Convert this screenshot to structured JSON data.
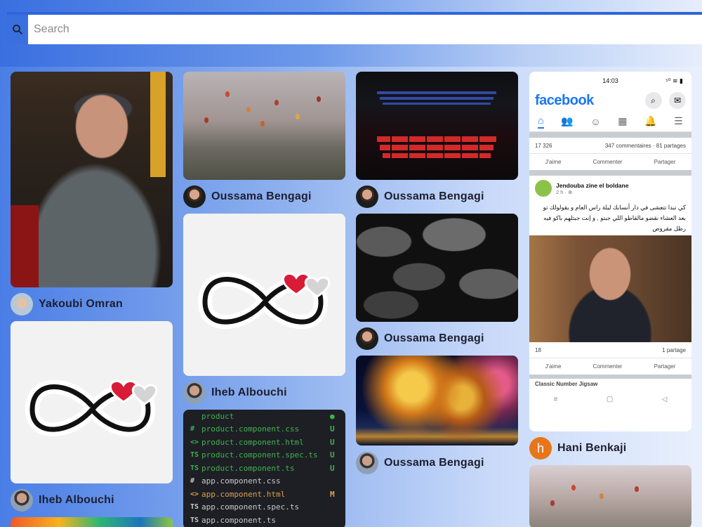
{
  "search": {
    "placeholder": "Search"
  },
  "pins": {
    "c1": [
      {
        "author": "Yakoubi Omran"
      },
      {
        "author": "Iheb Albouchi"
      }
    ],
    "c2": [
      {
        "author": "Oussama Bengagi"
      },
      {
        "author": "Iheb Albouchi"
      }
    ],
    "c3": [
      {
        "author": "Oussama Bengagi"
      },
      {
        "author": "Oussama Bengagi"
      },
      {
        "author": "Oussama Bengagi"
      }
    ],
    "c4": [
      {
        "author": "Hani Benkaji",
        "avatar_letter": "h"
      }
    ]
  },
  "code_pin": {
    "lines": [
      {
        "icon": "",
        "text": "product",
        "status": "●",
        "color": "#3fb24f"
      },
      {
        "icon": "#",
        "text": "product.component.css",
        "status": "U",
        "color": "#3fb24f"
      },
      {
        "icon": "<>",
        "text": "product.component.html",
        "status": "U",
        "color": "#3fb24f"
      },
      {
        "icon": "TS",
        "text": "product.component.spec.ts",
        "status": "U",
        "color": "#3fb24f"
      },
      {
        "icon": "TS",
        "text": "product.component.ts",
        "status": "U",
        "color": "#3fb24f"
      },
      {
        "icon": "#",
        "text": "app.component.css",
        "status": "",
        "color": "#c9c9c9"
      },
      {
        "icon": "<>",
        "text": "app.component.html",
        "status": "M",
        "color": "#d9a04a"
      },
      {
        "icon": "TS",
        "text": "app.component.spec.ts",
        "status": "",
        "color": "#c9c9c9"
      },
      {
        "icon": "TS",
        "text": "app.component.ts",
        "status": "",
        "color": "#c9c9c9"
      }
    ]
  },
  "facebook_pin": {
    "time": "14:03",
    "status_right": "⁵⁰ ≋ ▮",
    "logo": "facebook",
    "reactions_count": "17 326",
    "comments_shares": "347 commentaires · 81 partages",
    "like": "J'aime",
    "comment": "Commenter",
    "share": "Partager",
    "page_name": "Jendouba zine el boldane",
    "post_time": "2 h · ⊕",
    "post_text": "كي تبدا تتعشى في دار أنسابك ليلة راس العام و يقولولك تو بعد العشاء نقضو مالقاطو اللي جبتو , و إنت جبتلهم باكو فيه رطل مقروض",
    "photo_reactions": "18",
    "photo_shares": "1 partage",
    "next_post": "Classic Number Jigsaw"
  },
  "colors": {
    "accent": "#2f64dc",
    "facebook_blue": "#1877f2"
  }
}
